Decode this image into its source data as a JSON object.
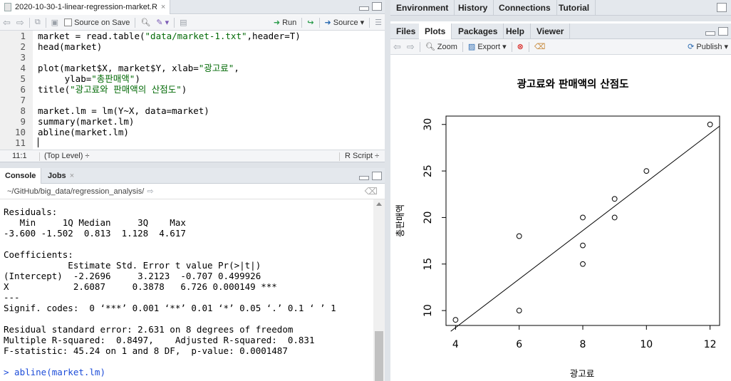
{
  "source": {
    "file_tab": "2020-10-30-1-linear-regression-market.R",
    "toolbar": {
      "source_on_save": "Source on Save",
      "run": "Run",
      "source": "Source"
    },
    "lines": [
      {
        "n": "1",
        "code": "market = read.table(\"data/market-1.txt\",header=T)"
      },
      {
        "n": "2",
        "code": "head(market)"
      },
      {
        "n": "3",
        "code": ""
      },
      {
        "n": "4",
        "code": "plot(market$X, market$Y, xlab=\"광고료\","
      },
      {
        "n": "5",
        "code": "     ylab=\"총판매액\")"
      },
      {
        "n": "6",
        "code": "title(\"광고료와 판매액의 산점도\")"
      },
      {
        "n": "7",
        "code": ""
      },
      {
        "n": "8",
        "code": "market.lm = lm(Y~X, data=market)"
      },
      {
        "n": "9",
        "code": "summary(market.lm)"
      },
      {
        "n": "10",
        "code": "abline(market.lm)"
      },
      {
        "n": "11",
        "code": ""
      }
    ],
    "status": {
      "position": "11:1",
      "scope": "(Top Level) ÷",
      "filetype": "R Script ÷"
    }
  },
  "console": {
    "tabs": [
      "Console",
      "Jobs"
    ],
    "path": "~/GitHub/big_data/regression_analysis/",
    "lines": [
      "Residuals:",
      "   Min     1Q Median     3Q    Max",
      "-3.600 -1.502  0.813  1.128  4.617",
      "",
      "Coefficients:",
      "            Estimate Std. Error t value Pr(>|t|)",
      "(Intercept)  -2.2696     3.2123  -0.707 0.499926",
      "X            2.6087     0.3878   6.726 0.000149 ***",
      "---",
      "Signif. codes:  0 ‘***’ 0.001 ‘**’ 0.01 ‘*’ 0.05 ‘.’ 0.1 ‘ ’ 1",
      "",
      "Residual standard error: 2.631 on 8 degrees of freedom",
      "Multiple R-squared:  0.8497,    Adjusted R-squared:  0.831",
      "F-statistic: 45.24 on 1 and 8 DF,  p-value: 0.0001487",
      "",
      "> abline(market.lm)"
    ]
  },
  "env_tabs": [
    "Environment",
    "History",
    "Connections",
    "Tutorial"
  ],
  "files_tabs": [
    "Files",
    "Plots",
    "Packages",
    "Help",
    "Viewer"
  ],
  "plots_toolbar": {
    "zoom": "Zoom",
    "export": "Export",
    "publish": "Publish"
  },
  "chart_data": {
    "type": "scatter",
    "title": "광고료와 판매액의 산점도",
    "xlabel": "광고료",
    "ylabel": "총판매액",
    "xlim": [
      4,
      12
    ],
    "ylim": [
      9,
      30
    ],
    "xticks": [
      4,
      6,
      8,
      10,
      12
    ],
    "yticks": [
      10,
      15,
      20,
      25,
      30
    ],
    "points": [
      {
        "x": 4,
        "y": 9
      },
      {
        "x": 6,
        "y": 10
      },
      {
        "x": 6,
        "y": 18
      },
      {
        "x": 8,
        "y": 15
      },
      {
        "x": 8,
        "y": 17
      },
      {
        "x": 8,
        "y": 20
      },
      {
        "x": 9,
        "y": 20
      },
      {
        "x": 9,
        "y": 22
      },
      {
        "x": 10,
        "y": 25
      },
      {
        "x": 12,
        "y": 30
      }
    ],
    "regression": {
      "intercept": -2.2696,
      "slope": 2.6087
    }
  }
}
